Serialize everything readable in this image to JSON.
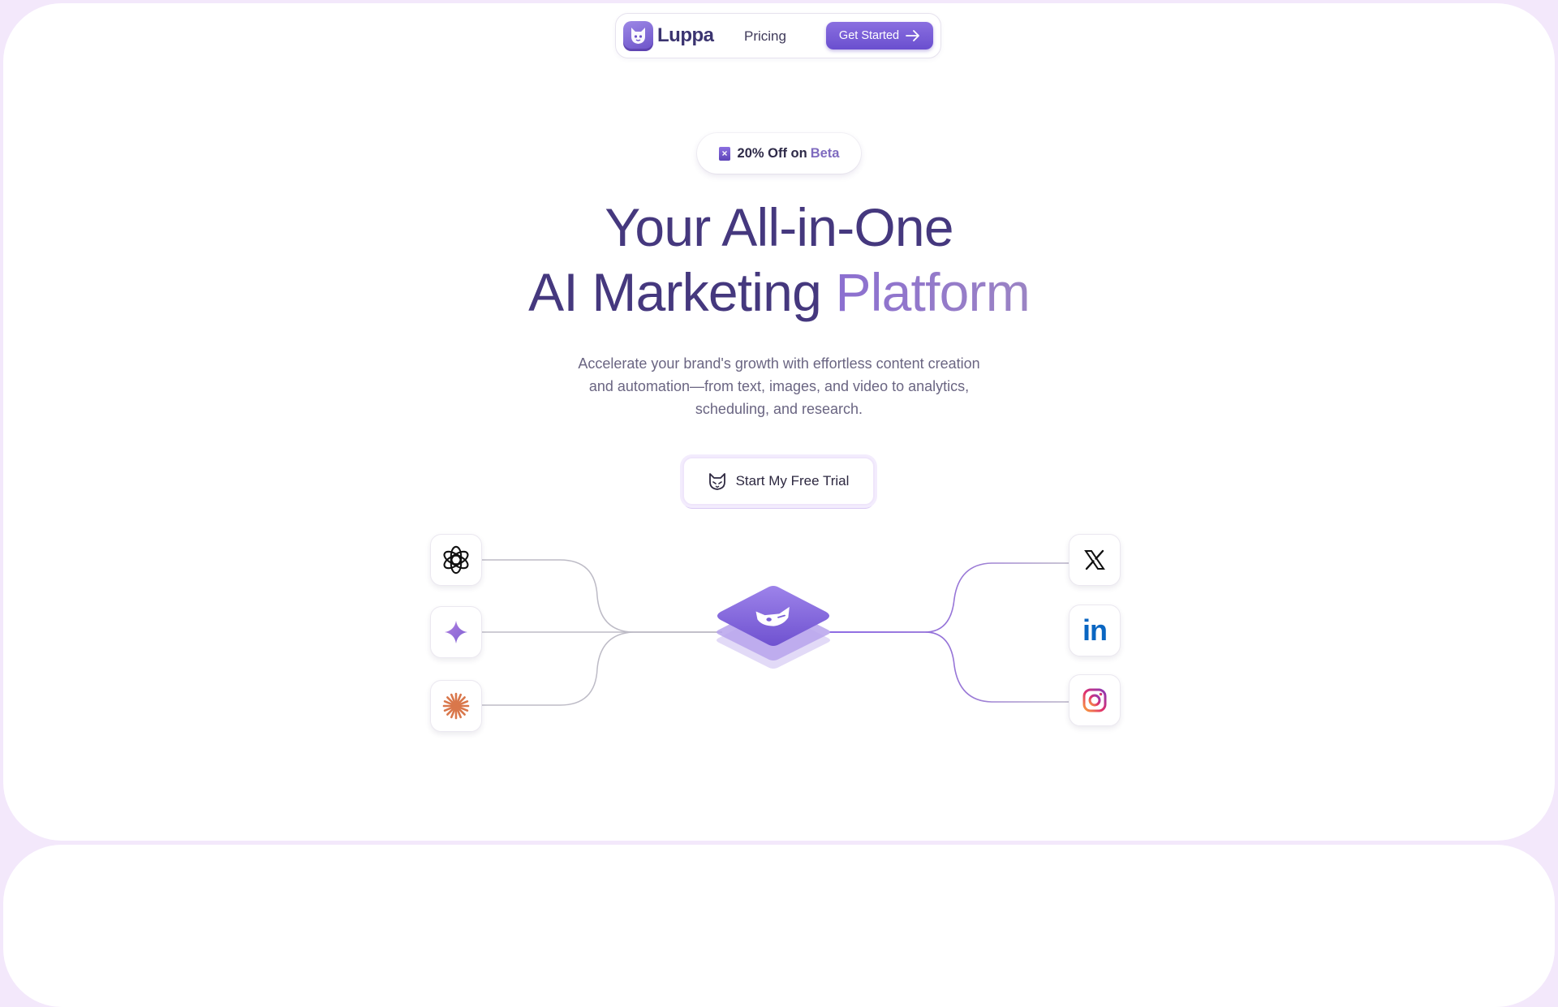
{
  "nav": {
    "brand": "Luppa",
    "pricing_label": "Pricing",
    "cta_label": "Get Started"
  },
  "badge": {
    "discount": "20% Off on",
    "accent": "Beta"
  },
  "hero": {
    "headline_line1": "Your All-in-One",
    "headline_line2_a": "AI Marketing",
    "headline_line2_b": "Platform",
    "subtitle_line1": "Accelerate your brand's growth with effortless content creation",
    "subtitle_line2": "and automation—from text, images, and video to analytics,",
    "subtitle_line3": "scheduling, and research.",
    "cta_label": "Start My Free Trial"
  },
  "integrations": {
    "left": [
      "openai-icon",
      "gemini-icon",
      "claude-icon"
    ],
    "right": [
      "x-icon",
      "linkedin-icon",
      "instagram-icon"
    ],
    "linkedin_text": "in",
    "colors": {
      "gemini": "#8f72d6",
      "claude": "#d9774b",
      "linkedin": "#0a66c2",
      "connector_left": "#b9b7c2",
      "connector_right": "#8a5fd9"
    }
  },
  "colors": {
    "background": "#f3e8fb",
    "brand_purple": "#6a4fcf",
    "headline": "#45387e"
  }
}
